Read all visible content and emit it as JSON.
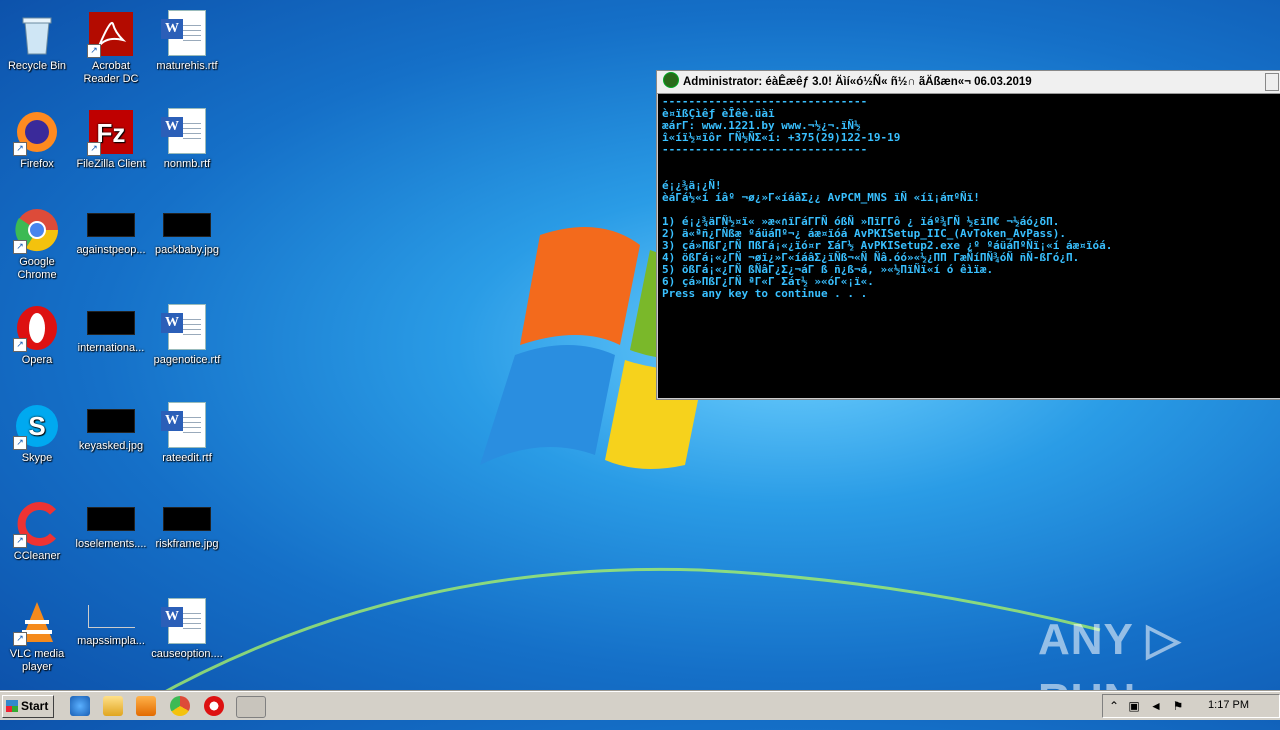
{
  "desktop": {
    "icons": [
      {
        "label": "Recycle Bin"
      },
      {
        "label": "Acrobat Reader DC"
      },
      {
        "label": "maturehis.rtf"
      },
      {
        "label": "Firefox"
      },
      {
        "label": "FileZilla Client"
      },
      {
        "label": "nonmb.rtf"
      },
      {
        "label": "Google Chrome"
      },
      {
        "label": "againstpeop..."
      },
      {
        "label": "packbaby.jpg"
      },
      {
        "label": "Opera"
      },
      {
        "label": "internationa..."
      },
      {
        "label": "pagenotice.rtf"
      },
      {
        "label": "Skype"
      },
      {
        "label": "keyasked.jpg"
      },
      {
        "label": "rateedit.rtf"
      },
      {
        "label": "CCleaner"
      },
      {
        "label": "loselements...."
      },
      {
        "label": "riskframe.jpg"
      },
      {
        "label": "VLC media player"
      },
      {
        "label": "mapssimpla..."
      },
      {
        "label": "causeoption...."
      }
    ]
  },
  "console": {
    "title": "Administrator: éàÊæêƒ 3.0! Äìí«ó½Ñ« ñ½∩ ãÄßæn«¬ 06.03.2019",
    "lines": [
      "-------------------------------",
      "è¤ïßÇìêƒ èÎêè.üàï",
      "æárΓ: www.1221.by www.¬½¿¬.ïÑ½",
      "î«íï½¤ïôr ΓÑ½ÑΣ«í: +375(29)122-19-19",
      "-------------------------------",
      "",
      "",
      "é¡¿¾ä¡¿Ñ!",
      "èáΓá½«í íâº ¬ø¿»Γ«íáâΣ¿¿ AvPCM_MNS ïÑ «íï¡áπºÑï!",
      "",
      "1) é¡¿¾äΓÑ½¤ï« »æ«∩ïΓáΓΓÑ óßÑ »ΠïΓΓô ¿ ïáº¾ΓÑ ½εïΠ€ ¬½áó¿δΠ.",
      "2) ä«ªñ¿ΓÑßæ ºáüáΠº¬¿ áæ¤ïóá AvPKISetup_IIC_(AvToken_AvPass).",
      "3) çá»ΠßΓ¿ΓÑ ΠßΓá¡«¿ïó¤r ΣáΓ½ AvPKISetup2.exe ¿º ºáüáΠºÑï¡«í áæ¤ïóá.",
      "4) ößΓá¡«¿ΓÑ ¬øï¿»Γ«íáâΣ¿ïÑß¬«Ñ Ñâ.óó»«½¿ΠΠ ΓæÑíΠÑ¾óÑ ñÑ-ßΓó¿Π.",
      "5) ößΓá¡«¿ΓÑ ßÑâΓ¿Σ¿¬áΓ ß ñ¿ß¬á, »«½ΠïÑï«í ó êìïæ.",
      "6) çá»ΠßΓ¿ΓÑ ªΓ«Γ Σáτ½ »«óΓ«¡ï«.",
      "Press any key to continue . . ."
    ]
  },
  "watermark": {
    "text": "ANY ▷ RUN"
  },
  "taskbar": {
    "start_label": "Start",
    "clock": "1:17 PM"
  },
  "colors": {
    "console_text": "#39c0ff",
    "taskbar": "#d4d0c8"
  }
}
